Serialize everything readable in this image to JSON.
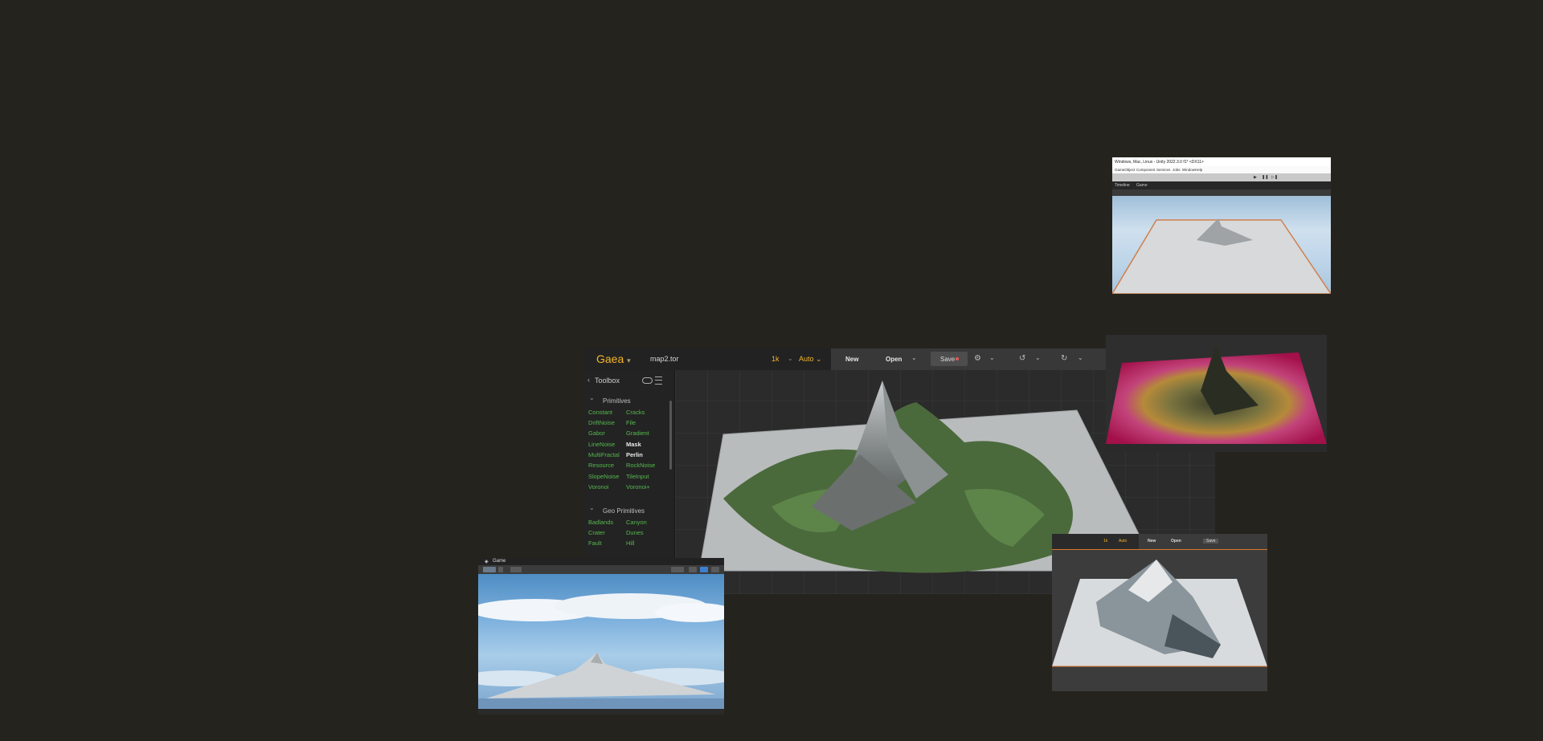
{
  "gaea": {
    "brand": "Gaea",
    "filename": "map2.tor",
    "resolution": "1k",
    "mode": "Auto",
    "buttons": {
      "new": "New",
      "open": "Open",
      "save": "Save"
    },
    "toolbox": {
      "title": "Toolbox",
      "sections": [
        {
          "name": "Primitives",
          "items_left": [
            "Constant",
            "DriftNoise",
            "Gabor",
            "LineNoise",
            "MultiFractal",
            "Resource",
            "SlopeNoise",
            "Voronoi"
          ],
          "items_right": [
            "Cracks",
            "File",
            "Gradient",
            "Mask",
            "Perlin",
            "RockNoise",
            "TileInput",
            "Voronoi+"
          ]
        },
        {
          "name": "Geo Primitives",
          "items_left": [
            "Badlands",
            "Crater",
            "Fault"
          ],
          "items_right": [
            "Canyon",
            "Dunes",
            "Hill"
          ]
        }
      ],
      "highlighted": [
        "Mask",
        "Perlin"
      ]
    }
  },
  "unity_window": {
    "title": "Windows, Mac, Linux - Unity 2022.3.0 f1* <DX11>",
    "menu": [
      "GameObject",
      "Component",
      "Services",
      "Jobs",
      "Window",
      "Help"
    ],
    "tabs": [
      "Timeline",
      "Game"
    ]
  },
  "game_window": {
    "tab": "Game"
  },
  "colors": {
    "accent": "#f5b52a",
    "toolbox_item": "#56b84e",
    "background": "#24231d"
  }
}
